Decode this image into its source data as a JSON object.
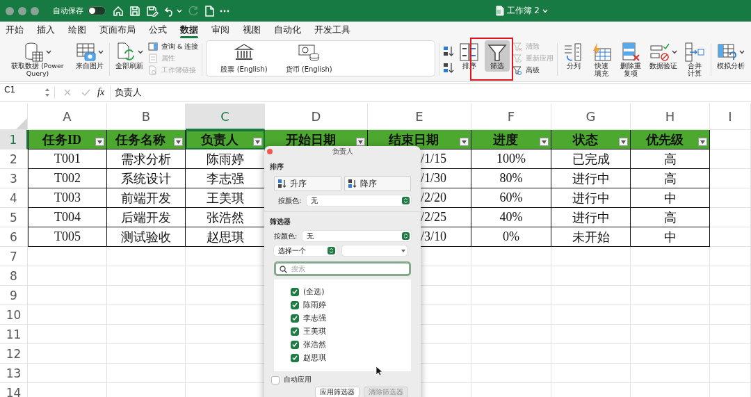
{
  "window": {
    "autosave_label": "自动保存",
    "autosave_on": false,
    "redo_disabled": true,
    "title": "工作簿 2"
  },
  "menu_tabs": [
    {
      "label": "开始",
      "selected": false
    },
    {
      "label": "插入",
      "selected": false
    },
    {
      "label": "绘图",
      "selected": false
    },
    {
      "label": "页面布局",
      "selected": false
    },
    {
      "label": "公式",
      "selected": false
    },
    {
      "label": "数据",
      "selected": true
    },
    {
      "label": "审阅",
      "selected": false
    },
    {
      "label": "视图",
      "selected": false
    },
    {
      "label": "自动化",
      "selected": false
    },
    {
      "label": "开发工具",
      "selected": false
    }
  ],
  "ribbon": [
    {
      "items": [
        {
          "kind": "large",
          "label": "获取数据 (Power Query)",
          "dropdown": true
        },
        {
          "kind": "large",
          "label": "来自图片",
          "dropdown": true
        }
      ]
    },
    {
      "items": [
        {
          "kind": "large",
          "label": "全部刷新",
          "dropdown": true
        },
        {
          "kind": "stack",
          "items": [
            {
              "label": "查询 & 连接",
              "disabled": false
            },
            {
              "label": "属性",
              "disabled": true
            },
            {
              "label": "工作簿链接",
              "disabled": true
            }
          ]
        }
      ]
    },
    {
      "items": [
        {
          "kind": "gallery",
          "items": [
            {
              "label": "股票 (English)"
            },
            {
              "label": "货币 (English)"
            }
          ]
        }
      ]
    },
    {
      "items": [
        {
          "kind": "sort-pair"
        },
        {
          "kind": "large",
          "label": "排序",
          "selected": false
        },
        {
          "kind": "large",
          "label": "筛选",
          "selected": true,
          "highlighted": true
        },
        {
          "kind": "stack",
          "items": [
            {
              "label": "清除",
              "disabled": true
            },
            {
              "label": "重新应用",
              "disabled": true
            },
            {
              "label": "高级",
              "disabled": false
            }
          ]
        }
      ]
    },
    {
      "items": [
        {
          "kind": "large",
          "label": "分列"
        },
        {
          "kind": "large",
          "label": "快速填充"
        },
        {
          "kind": "large",
          "label": "删除重复项"
        },
        {
          "kind": "large",
          "label": "数据验证",
          "dropdown": true
        },
        {
          "kind": "large",
          "label": "合并计算"
        }
      ]
    },
    {
      "items": [
        {
          "kind": "large",
          "label": "模拟分析",
          "dropdown": true
        }
      ]
    }
  ],
  "formula_bar": {
    "name_box": "C1",
    "fx_label": "fx",
    "content": "负责人"
  },
  "sheet": {
    "columns": [
      {
        "label": "A",
        "selected": false
      },
      {
        "label": "B",
        "selected": false
      },
      {
        "label": "C",
        "selected": true
      },
      {
        "label": "D",
        "selected": false
      },
      {
        "label": "E",
        "selected": false
      },
      {
        "label": "F",
        "selected": false
      },
      {
        "label": "G",
        "selected": false
      },
      {
        "label": "H",
        "selected": false
      },
      {
        "label": "I",
        "selected": false
      }
    ],
    "rows": [
      {
        "label": "1",
        "selected": true
      },
      {
        "label": "2",
        "selected": false
      },
      {
        "label": "3",
        "selected": false
      },
      {
        "label": "4",
        "selected": false
      },
      {
        "label": "5",
        "selected": false
      },
      {
        "label": "6",
        "selected": false
      },
      {
        "label": "7",
        "selected": false
      },
      {
        "label": "8",
        "selected": false
      },
      {
        "label": "9",
        "selected": false
      },
      {
        "label": "10",
        "selected": false
      },
      {
        "label": "11",
        "selected": false
      },
      {
        "label": "12",
        "selected": false
      },
      {
        "label": "13",
        "selected": false
      },
      {
        "label": "14",
        "selected": false
      }
    ],
    "header_cells": [
      {
        "text": "任务ID",
        "selected": false
      },
      {
        "text": "任务名称",
        "selected": false
      },
      {
        "text": "负责人",
        "selected": true
      },
      {
        "text": "开始日期",
        "selected": false
      },
      {
        "text": "结束日期",
        "selected": false
      },
      {
        "text": "进度",
        "selected": false
      },
      {
        "text": "状态",
        "selected": false
      },
      {
        "text": "优先级",
        "selected": false
      }
    ],
    "data_rows": [
      {
        "cells": [
          "T001",
          "需求分析",
          "陈雨婷",
          "/1/15",
          "100%",
          "已完成",
          "高"
        ]
      },
      {
        "cells": [
          "T002",
          "系统设计",
          "李志强",
          "/1/30",
          "80%",
          "进行中",
          "高"
        ]
      },
      {
        "cells": [
          "T003",
          "前端开发",
          "王美琪",
          "/2/20",
          "60%",
          "进行中",
          "中"
        ]
      },
      {
        "cells": [
          "T004",
          "后端开发",
          "张浩然",
          "/2/25",
          "40%",
          "进行中",
          "高"
        ]
      },
      {
        "cells": [
          "T005",
          "测试验收",
          "赵思琪",
          "/3/10",
          "0%",
          "未开始",
          "中"
        ]
      }
    ]
  },
  "filter_popup": {
    "title": "负责人",
    "sort_heading": "排序",
    "sort_buttons": [
      "升序",
      "降序"
    ],
    "sort_color_label": "按颜色:",
    "sort_color_value": "无",
    "filter_heading": "筛选器",
    "filter_color_label": "按颜色:",
    "filter_color_value": "无",
    "condition_select": "选择一个",
    "search_placeholder": "搜索",
    "items": [
      {
        "label": "(全选)",
        "checked": true
      },
      {
        "label": "陈雨婷",
        "checked": true
      },
      {
        "label": "李志强",
        "checked": true
      },
      {
        "label": "王美琪",
        "checked": true
      },
      {
        "label": "张浩然",
        "checked": true
      },
      {
        "label": "赵思琪",
        "checked": true
      }
    ],
    "auto_apply": {
      "label": "自动应用",
      "checked": false
    },
    "apply_button": {
      "label": "应用筛选器",
      "disabled": false
    },
    "clear_button": {
      "label": "清除筛选器",
      "disabled": true
    }
  }
}
